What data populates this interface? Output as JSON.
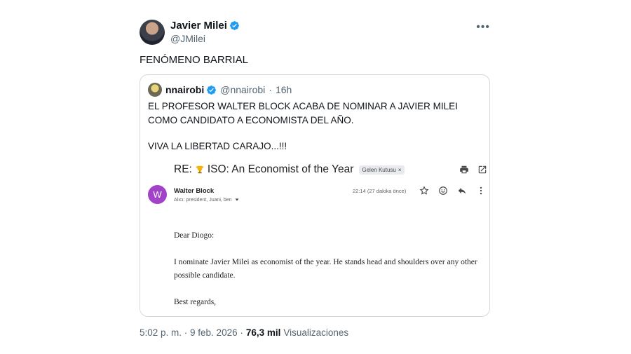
{
  "author": {
    "name": "Javier Milei",
    "handle": "@JMilei",
    "verified": true
  },
  "icons": {
    "more": "more-horizontal-icon",
    "verified": "verified-badge-icon"
  },
  "tweet": {
    "text": "FENÓMENO BARRIAL"
  },
  "quote": {
    "name": "nnairobi",
    "handle": "@nnairobi",
    "separator": "·",
    "time": "16h",
    "paragraphs": [
      "EL PROFESOR WALTER BLOCK ACABA DE NOMINAR A JAVIER MILEI COMO CANDIDATO A ECONOMISTA DEL AÑO.",
      "VIVA LA LIBERTAD CARAJO...!!!"
    ],
    "email": {
      "subject_prefix": "RE:",
      "subject": "ISO: An Economist of the Year",
      "label": "Gelen Kutusu",
      "label_close": "×",
      "sender_initial": "W",
      "sender_name": "Walter Block",
      "recipients": "Alıcı: president, Juani, ben",
      "time": "22:14 (27 dakika önce)",
      "avatar_color": "#a142c9",
      "letter": {
        "greeting": "Dear Diogo:",
        "body": "I nominate Javier Milei as economist of the year. He stands head and shoulders over any other possible candidate.",
        "closing": "Best regards,"
      }
    }
  },
  "footer": {
    "timestamp": "5:02 p. m. · 9 feb. 2026 ·",
    "views_count": "76,3 mil",
    "views_label": "Visualizaciones"
  },
  "colors": {
    "verified_blue": "#1d9bf0",
    "text_secondary": "#536471",
    "border": "#cfd9de"
  }
}
